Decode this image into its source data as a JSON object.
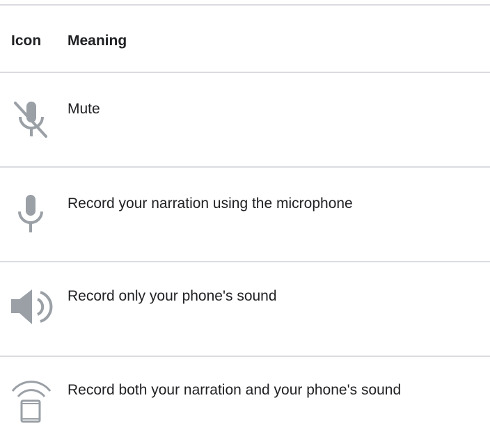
{
  "table": {
    "headers": {
      "icon": "Icon",
      "meaning": "Meaning"
    },
    "rows": [
      {
        "icon": "mic-off-icon",
        "meaning": "Mute"
      },
      {
        "icon": "mic-icon",
        "meaning": "Record your narration using the microphone"
      },
      {
        "icon": "speaker-volume-icon",
        "meaning": "Record only your phone's sound"
      },
      {
        "icon": "phone-broadcast-icon",
        "meaning": "Record both your narration and your phone's sound"
      }
    ]
  },
  "colors": {
    "text": "#202124",
    "divider": "#dadce0",
    "icon": "#9aa0a6"
  }
}
